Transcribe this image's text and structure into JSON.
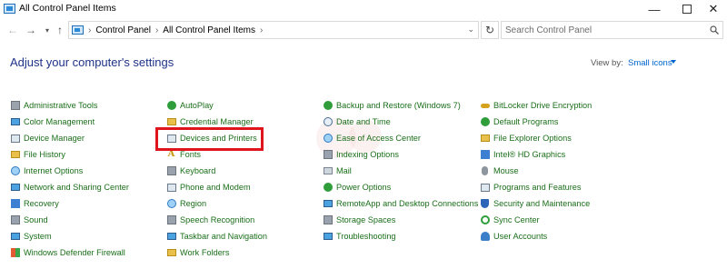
{
  "window": {
    "title": "All Control Panel Items",
    "minimize_glyph": "—",
    "close_glyph": "✕"
  },
  "nav": {
    "back_glyph": "←",
    "forward_glyph": "→",
    "recent_glyph": "▾",
    "up_glyph": "↑",
    "refresh_glyph": "↻",
    "breadcrumb": [
      "Control Panel",
      "All Control Panel Items"
    ],
    "crumb_separator": "›",
    "dropdown_glyph": "⌄"
  },
  "search": {
    "placeholder": "Search Control Panel"
  },
  "header": {
    "title": "Adjust your computer's settings",
    "view_by_label": "View by:",
    "view_by_value": "Small icons"
  },
  "columns": [
    {
      "items": [
        {
          "label": "Administrative Tools",
          "icon": "admin-tools-icon"
        },
        {
          "label": "Color Management",
          "icon": "color-management-icon"
        },
        {
          "label": "Device Manager",
          "icon": "device-manager-icon"
        },
        {
          "label": "File History",
          "icon": "file-history-icon"
        },
        {
          "label": "Internet Options",
          "icon": "internet-options-icon"
        },
        {
          "label": "Network and Sharing Center",
          "icon": "network-icon"
        },
        {
          "label": "Recovery",
          "icon": "recovery-icon"
        },
        {
          "label": "Sound",
          "icon": "sound-icon"
        },
        {
          "label": "System",
          "icon": "system-icon"
        },
        {
          "label": "Windows Defender Firewall",
          "icon": "firewall-icon"
        }
      ]
    },
    {
      "items": [
        {
          "label": "AutoPlay",
          "icon": "autoplay-icon"
        },
        {
          "label": "Credential Manager",
          "icon": "credential-manager-icon"
        },
        {
          "label": "Devices and Printers",
          "icon": "devices-printers-icon"
        },
        {
          "label": "Fonts",
          "icon": "fonts-icon"
        },
        {
          "label": "Keyboard",
          "icon": "keyboard-icon"
        },
        {
          "label": "Phone and Modem",
          "icon": "phone-modem-icon"
        },
        {
          "label": "Region",
          "icon": "region-icon"
        },
        {
          "label": "Speech Recognition",
          "icon": "speech-recognition-icon"
        },
        {
          "label": "Taskbar and Navigation",
          "icon": "taskbar-icon"
        },
        {
          "label": "Work Folders",
          "icon": "work-folders-icon"
        }
      ]
    },
    {
      "items": [
        {
          "label": "Backup and Restore (Windows 7)",
          "icon": "backup-restore-icon"
        },
        {
          "label": "Date and Time",
          "icon": "date-time-icon"
        },
        {
          "label": "Ease of Access Center",
          "icon": "ease-of-access-icon"
        },
        {
          "label": "Indexing Options",
          "icon": "indexing-options-icon"
        },
        {
          "label": "Mail",
          "icon": "mail-icon"
        },
        {
          "label": "Power Options",
          "icon": "power-options-icon"
        },
        {
          "label": "RemoteApp and Desktop Connections",
          "icon": "remoteapp-icon"
        },
        {
          "label": "Storage Spaces",
          "icon": "storage-spaces-icon"
        },
        {
          "label": "Troubleshooting",
          "icon": "troubleshooting-icon"
        }
      ]
    },
    {
      "items": [
        {
          "label": "BitLocker Drive Encryption",
          "icon": "bitlocker-icon"
        },
        {
          "label": "Default Programs",
          "icon": "default-programs-icon"
        },
        {
          "label": "File Explorer Options",
          "icon": "file-explorer-options-icon"
        },
        {
          "label": "Intel® HD Graphics",
          "icon": "intel-graphics-icon"
        },
        {
          "label": "Mouse",
          "icon": "mouse-icon"
        },
        {
          "label": "Programs and Features",
          "icon": "programs-features-icon"
        },
        {
          "label": "Security and Maintenance",
          "icon": "security-maintenance-icon"
        },
        {
          "label": "Sync Center",
          "icon": "sync-center-icon"
        },
        {
          "label": "User Accounts",
          "icon": "user-accounts-icon"
        }
      ]
    }
  ],
  "colors": {
    "item_link": "#1a6e1a",
    "heading": "#1e3287",
    "view_by_link": "#0066cc",
    "highlight": "#e0141c"
  }
}
